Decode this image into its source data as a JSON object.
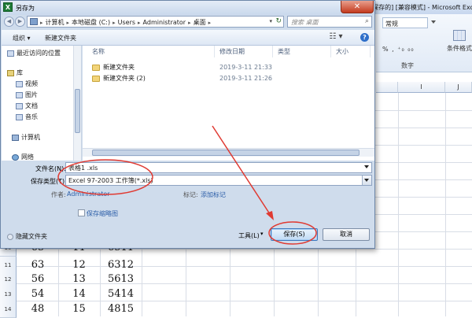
{
  "excel": {
    "title": "[兼容模式] - Microsoft Excel",
    "title_prefix": "b保存的]",
    "number_format": "常规",
    "number_tools": "% , ⁺₀ ₀₀",
    "number_group_label": "数字",
    "cond_format": "条件格式",
    "columns": [
      "I",
      "J"
    ],
    "row_numbers": [
      "10",
      "11",
      "12",
      "13",
      "14"
    ],
    "rows": [
      [
        "65",
        "11",
        "6511"
      ],
      [
        "63",
        "12",
        "6312"
      ],
      [
        "56",
        "13",
        "5613"
      ],
      [
        "54",
        "14",
        "5414"
      ],
      [
        "48",
        "15",
        "4815"
      ]
    ]
  },
  "dialog": {
    "title": "另存为",
    "app_icon_letter": "X",
    "close_glyph": "✕",
    "back_glyph": "◀",
    "forward_glyph": "▶",
    "address": [
      "计算机",
      "本地磁盘 (C:)",
      "Users",
      "Administrator",
      "桌面"
    ],
    "search_placeholder": "搜索 桌面",
    "toolbar": {
      "organize": "组织 ▾",
      "new_folder": "新建文件夹",
      "view": "☷ ▾",
      "help": "?"
    },
    "nav_items": [
      {
        "label": "最近访问的位置",
        "icon": "recent-icon"
      },
      {
        "label": "库",
        "icon": "library-icon"
      },
      {
        "label": "视频",
        "icon": "video-icon"
      },
      {
        "label": "图片",
        "icon": "pictures-icon"
      },
      {
        "label": "文档",
        "icon": "documents-icon"
      },
      {
        "label": "音乐",
        "icon": "music-icon"
      },
      {
        "label": "计算机",
        "icon": "computer-icon"
      },
      {
        "label": "网络",
        "icon": "network-icon"
      }
    ],
    "columns": {
      "name": "名称",
      "modified": "修改日期",
      "type": "类型",
      "size": "大小"
    },
    "files": [
      {
        "name": "新建文件夹",
        "date": "2019-3-11 21:33",
        "type": "文件夹"
      },
      {
        "name": "新建文件夹 (2)",
        "date": "2019-3-11 21:26",
        "type": "文件夹"
      }
    ],
    "filename_label": "文件名(N):",
    "filename_value": "表格1 .xls",
    "filetype_label": "保存类型(T):",
    "filetype_value": "Excel 97-2003 工作簿(*.xls)",
    "author_label": "作者:",
    "author_value": "Administrator",
    "tags_label": "标记:",
    "tags_value": "添加标记",
    "thumbnail_label": "保存缩略图",
    "hide_folders": "隐藏文件夹",
    "tools": "工具(L)",
    "save": "保存(S)",
    "cancel": "取消"
  },
  "colors": {
    "annotation": "#e03a32",
    "link": "#2c5ea8",
    "primary": "#3f78bd"
  }
}
